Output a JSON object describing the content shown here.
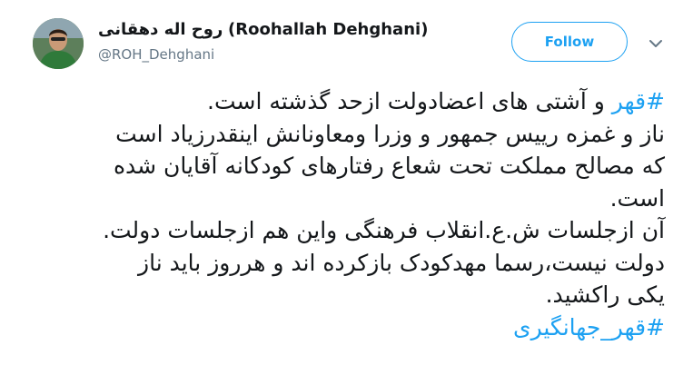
{
  "user": {
    "display_name_fa": "روح اله دهقانی",
    "display_name_en": "(Roohallah Dehghani)",
    "handle": "@ROH_Dehghani"
  },
  "actions": {
    "follow_label": "Follow",
    "menu_icon": "chevron-down-icon"
  },
  "tweet": {
    "line1_hashtag": "#قهر",
    "line1_text": " و آشتی های اعضادولت ازحد گذشته است.",
    "line2": "ناز و غمزه رییس جمهور و وزرا ومعاونانش اینقدرزیاد است",
    "line3": "که مصالح مملکت تحت شعاع رفتارهای کودکانه آقایان شده",
    "line4": "است.",
    "line5": "آن ازجلسات ش.ع.انقلاب فرهنگی واین هم ازجلسات دولت.",
    "line6": "دولت نیست،رسما مهدکودک بازکرده اند و هرروز باید ناز",
    "line7": "یکی راکشید.",
    "line8_hashtag": "#قهر_جهانگیری"
  },
  "colors": {
    "accent": "#1da1f2",
    "text": "#14171a",
    "muted": "#657786"
  }
}
